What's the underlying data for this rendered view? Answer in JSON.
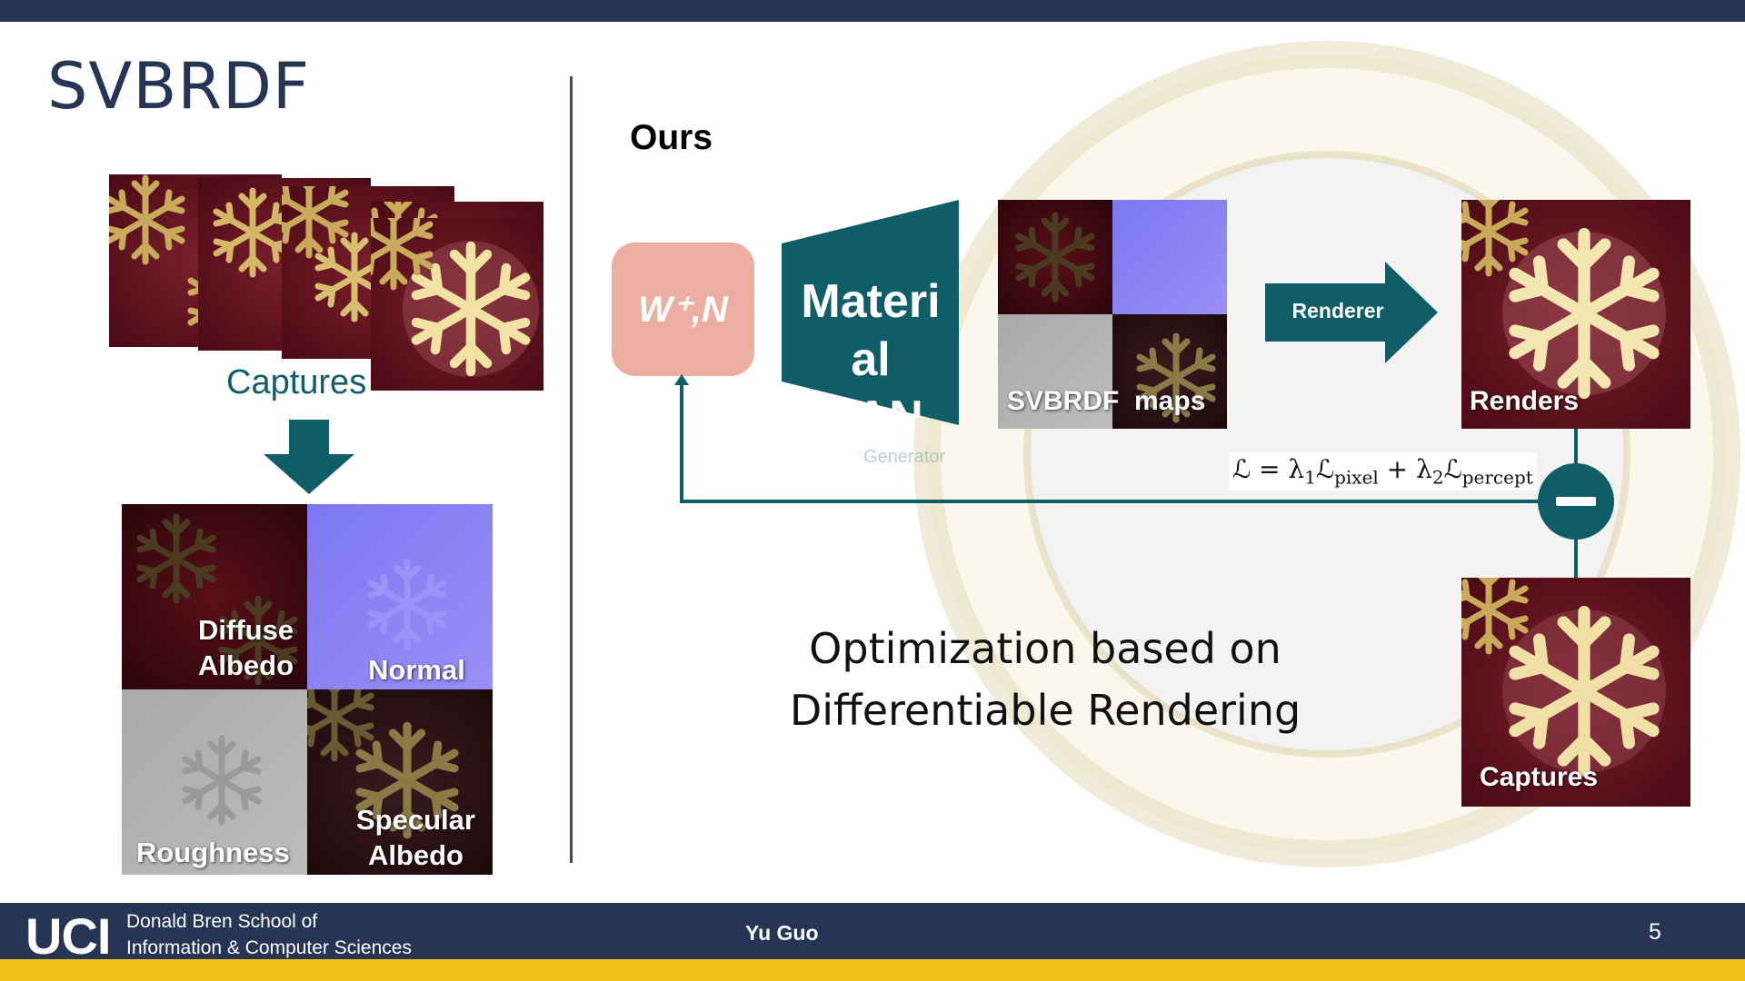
{
  "slide": {
    "title": "SVBRDF",
    "page_number": "5",
    "author": "Yu Guo"
  },
  "left_panel": {
    "captures_label": "Captures",
    "maps": {
      "diffuse_label": "Diffuse\nAlbedo",
      "normal_label": "Normal",
      "roughness_label": "Roughness",
      "specular_label": "Specular\nAlbedo"
    }
  },
  "right_panel": {
    "heading": "Ours",
    "latent_label": "W⁺,N",
    "generator_label": "Materi\nal\nGAN",
    "generator_sublabel": "Generator",
    "svbrdf_maps_label": "SVBRDF  maps",
    "renderer_label": "Renderer",
    "renders_label": "Renders",
    "captures_label": "Captures",
    "loss": {
      "lhs": "ℒ = λ",
      "sub1": "1",
      "term1": "ℒ",
      "sub_pixel": "pixel",
      "plus": " + λ",
      "sub2": "2",
      "term2": "ℒ",
      "sub_percept": "percept"
    },
    "caption_line1": "Optimization based on",
    "caption_line2": "Differentiable Rendering"
  },
  "footer": {
    "logo": "UCI",
    "school_line1": "Donald Bren School of",
    "school_line2": "Information & Computer Sciences"
  },
  "colors": {
    "navy": "#263556",
    "teal": "#0f5e67",
    "gold": "#f2c019",
    "salmon": "#ebaea0",
    "fabric_red": "#5a0f1c",
    "normal_blue": "#8a84f5"
  }
}
